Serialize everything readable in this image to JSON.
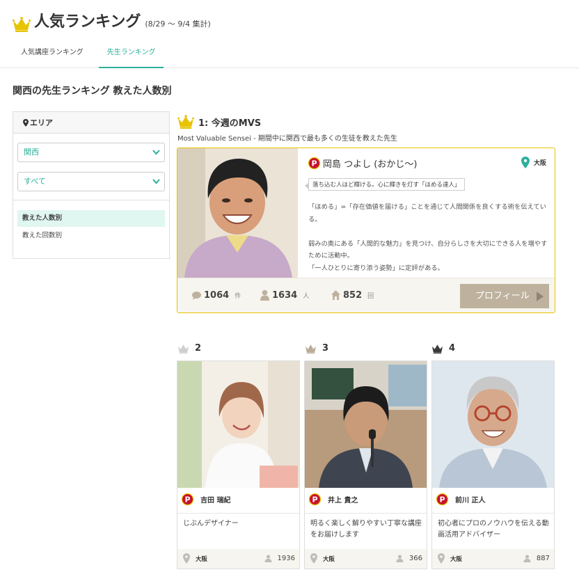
{
  "header": {
    "title": "人気ランキング",
    "period": "(8/29 〜 9/4 集計)",
    "tabs": [
      {
        "label": "人気講座ランキング",
        "active": false
      },
      {
        "label": "先生ランキング",
        "active": true
      }
    ]
  },
  "section_heading": "関西の先生ランキング 教えた人数別",
  "sidebar": {
    "area_label": "エリア",
    "region_select": "関西",
    "city_select": "すべて",
    "filters": [
      {
        "label": "教えた人数別",
        "active": true
      },
      {
        "label": "教えた回数別",
        "active": false
      }
    ]
  },
  "mvs": {
    "heading": "1: 今週のMVS",
    "subheading": "Most Valuable Sensei - 期間中に関西で最も多くの生徒を教えた先生",
    "name": "岡島 つよし (おかじ〜)",
    "location": "大阪",
    "tagline": "落ち込む人ほど輝ける。心に輝きを灯す「ほめる達人」",
    "description": [
      "「ほめる」=「存在価値を届ける」ことを通じて人間関係を良くする術を伝えている。",
      "",
      "弱みの奥にある「人間的な魅力」を見つけ、自分らしさを大切にできる人を増やすために活動中。",
      "「一人ひとりに寄り添う姿勢」に定評がある。"
    ],
    "stats": {
      "reviews": "1064",
      "reviews_unit": "件",
      "students": "1634",
      "students_unit": "人",
      "classes": "852",
      "classes_unit": "回"
    },
    "profile_button": "プロフィール",
    "icons": [
      "crown-icon",
      "p-badge-icon",
      "map-pin-icon",
      "chat-bubble-icon",
      "user-icon",
      "house-icon"
    ]
  },
  "ranks": [
    {
      "rank": "2",
      "name": "吉田 瑞紀",
      "description": "じぶんデザイナー",
      "location": "大阪",
      "count": "1936",
      "crown_color": "#cfcfcf"
    },
    {
      "rank": "3",
      "name": "井上 貴之",
      "description": "明るく楽しく解りやすい丁寧な講座をお届けします",
      "location": "大阪",
      "count": "366",
      "crown_color": "#b9ad98"
    },
    {
      "rank": "4",
      "name": "前川 正人",
      "description": "初心者にプロのノウハウを伝える動画活用アドバイザー",
      "location": "大阪",
      "count": "887",
      "crown_color": "#3a3a3a"
    }
  ],
  "colors": {
    "accent": "#2ab09a",
    "gold": "#e8c300",
    "badge_red": "#c8102e",
    "profile_button": "#beb29e"
  }
}
